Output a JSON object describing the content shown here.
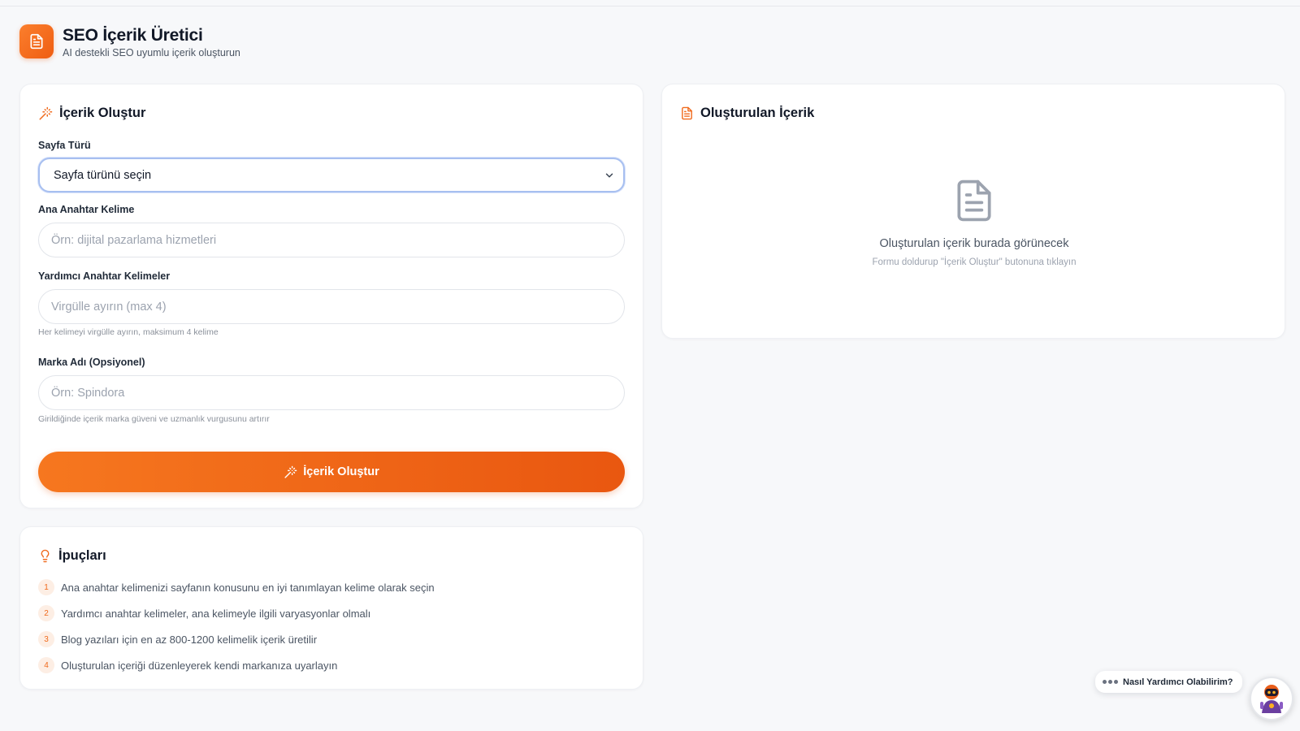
{
  "header": {
    "title": "SEO İçerik Üretici",
    "subtitle": "AI destekli SEO uyumlu içerik oluşturun",
    "logo_icon": "document-icon"
  },
  "form": {
    "title": "İçerik Oluştur",
    "page_type": {
      "label": "Sayfa Türü",
      "value": "Sayfa türünü seçin"
    },
    "main_keyword": {
      "label": "Ana Anahtar Kelime",
      "placeholder": "Örn: dijital pazarlama hizmetleri",
      "value": ""
    },
    "secondary_keywords": {
      "label": "Yardımcı Anahtar Kelimeler",
      "placeholder": "Virgülle ayırın (max 4)",
      "hint": "Her kelimeyi virgülle ayırın, maksimum 4 kelime",
      "value": ""
    },
    "brand": {
      "label": "Marka Adı (Opsiyonel)",
      "placeholder": "Örn: Spindora",
      "hint": "Girildiğinde içerik marka güveni ve uzmanlık vurgusunu artırır",
      "value": ""
    },
    "submit_label": "İçerik Oluştur"
  },
  "output": {
    "title": "Oluşturulan İçerik",
    "empty_title": "Oluşturulan içerik burada görünecek",
    "empty_subtitle": "Formu doldurup \"İçerik Oluştur\" butonuna tıklayın"
  },
  "tips": {
    "title": "İpuçları",
    "items": [
      {
        "num": "1",
        "text": "Ana anahtar kelimenizi sayfanın konusunu en iyi tanımlayan kelime olarak seçin"
      },
      {
        "num": "2",
        "text": "Yardımcı anahtar kelimeler, ana kelimeyle ilgili varyasyonlar olmalı"
      },
      {
        "num": "3",
        "text": "Blog yazıları için en az 800-1200 kelimelik içerik üretilir"
      },
      {
        "num": "4",
        "text": "Oluşturulan içeriği düzenleyerek kendi markanıza uyarlayın"
      }
    ]
  },
  "help": {
    "label": "Nasıl Yardımcı Olabilirim?"
  },
  "colors": {
    "accent": "#f06a1c",
    "accent_dark": "#e95710",
    "background": "#f7f8fa",
    "focus_ring": "#a7bff0"
  }
}
